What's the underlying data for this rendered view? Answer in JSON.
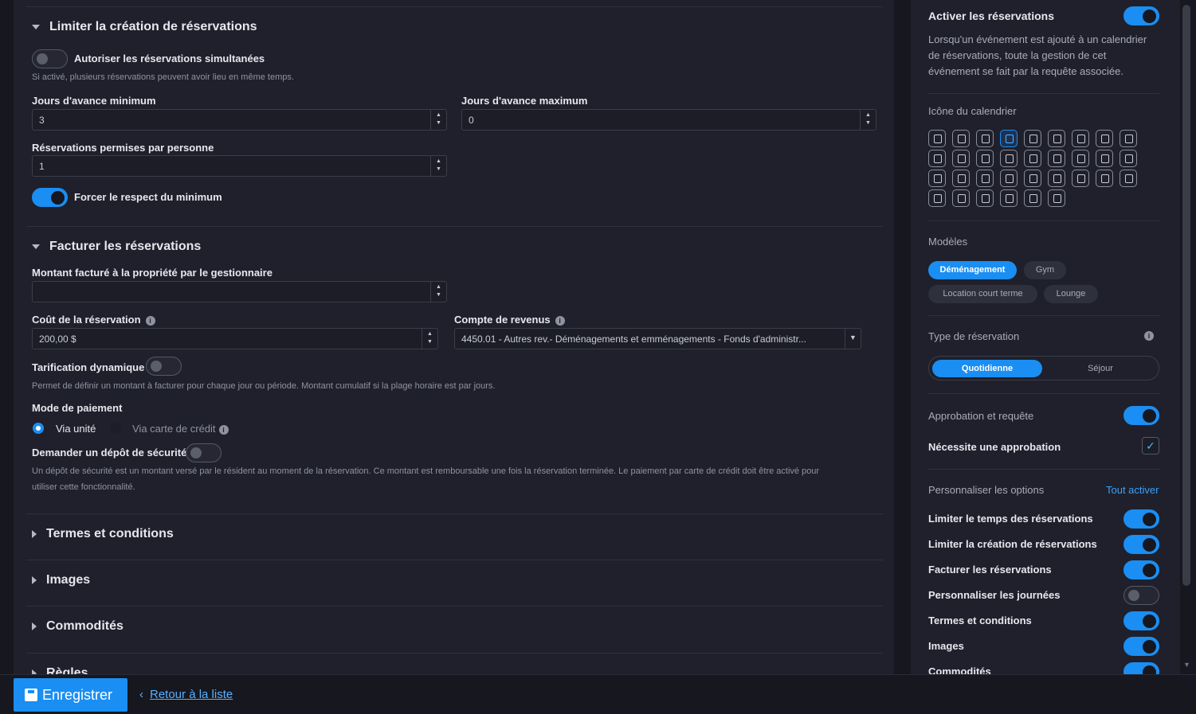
{
  "limit_section": {
    "title": "Limiter la création de réservations",
    "simultaneous_label": "Autoriser les réservations simultanées",
    "simultaneous_on": false,
    "simultaneous_help": "Si activé, plusieurs réservations peuvent avoir lieu en même temps.",
    "min_days_label": "Jours d'avance minimum",
    "min_days_value": "3",
    "max_days_label": "Jours d'avance maximum",
    "max_days_value": "0",
    "per_person_label": "Réservations permises par personne",
    "per_person_value": "1",
    "force_min_label": "Forcer le respect du minimum",
    "force_min_on": true
  },
  "billing_section": {
    "title": "Facturer les réservations",
    "amount_label": "Montant facturé à la propriété par le gestionnaire",
    "amount_value": "",
    "cost_label": "Coût de la réservation",
    "cost_value": "200,00 $",
    "account_label": "Compte de revenus",
    "account_value": "4450.01 - Autres rev.- Déménagements et emménagements - Fonds d'administr...",
    "dynamic_label": "Tarification dynamique",
    "dynamic_on": false,
    "dynamic_help": "Permet de définir un montant à facturer pour chaque jour ou période. Montant cumulatif si la plage horaire est par jours.",
    "payment_label": "Mode de paiement",
    "payment_options": [
      "Via unité",
      "Via carte de crédit"
    ],
    "payment_selected": "Via unité",
    "deposit_label": "Demander un dépôt de sécurité",
    "deposit_on": false,
    "deposit_help_1": "Un dépôt de sécurité est un montant versé par le résident au moment de la réservation. Ce montant est remboursable une fois la réservation terminée. Le paiement par carte de crédit doit être activé pour",
    "deposit_help_2": "utiliser cette fonctionnalité."
  },
  "collapsed_sections": [
    "Termes et conditions",
    "Images",
    "Commodités",
    "Règles"
  ],
  "sidebar": {
    "enable_label": "Activer les réservations",
    "enable_on": true,
    "enable_desc_1": "Lorsqu'un événement est ajouté à un calendrier",
    "enable_desc_2": "de réservations, toute la gestion de cet",
    "enable_desc_3": "événement se fait par la requête associée.",
    "icon_title": "Icône du calendrier",
    "icons": [
      "calendar-check-icon",
      "truck-icon",
      "people-moving-icon",
      "group-icon",
      "person-reception-icon",
      "tombstone-icon",
      "runner-icon",
      "swimmer-icon",
      "dumbbell-icon",
      "bicycle-icon",
      "bags-icon",
      "box-icon",
      "calendar-icon",
      "clipboard-icon",
      "flag-icon",
      "grill-icon",
      "car-icon",
      "building-icon",
      "garage-icon",
      "door-icon",
      "washer-icon",
      "binoculars-icon",
      "store-icon",
      "couch-icon",
      "bbq-icon",
      "pets-icon",
      "home-icon",
      "bed-icon",
      "map-pin-icon",
      "vacuum-icon",
      "garage-door-icon",
      "parking-icon",
      "spa-icon"
    ],
    "selected_icon": "group-icon",
    "models_title": "Modèles",
    "models": [
      "Déménagement",
      "Gym",
      "Location court terme",
      "Lounge"
    ],
    "selected_model": "Déménagement",
    "type_title": "Type de réservation",
    "types": [
      "Quotidienne",
      "Séjour"
    ],
    "selected_type": "Quotidienne",
    "approval_title": "Approbation et requête",
    "approval_on": true,
    "needs_approval_label": "Nécessite une approbation",
    "needs_approval_checked": true,
    "options_title": "Personnaliser les options",
    "enable_all": "Tout activer",
    "options": [
      {
        "label": "Limiter le temps des réservations",
        "on": true
      },
      {
        "label": "Limiter la création de réservations",
        "on": true
      },
      {
        "label": "Facturer les réservations",
        "on": true
      },
      {
        "label": "Personnaliser les journées",
        "on": false
      },
      {
        "label": "Termes et conditions",
        "on": true
      },
      {
        "label": "Images",
        "on": true
      },
      {
        "label": "Commodités",
        "on": true
      }
    ]
  },
  "footer": {
    "save_label": "Enregistrer",
    "back_label": "Retour à la liste"
  }
}
